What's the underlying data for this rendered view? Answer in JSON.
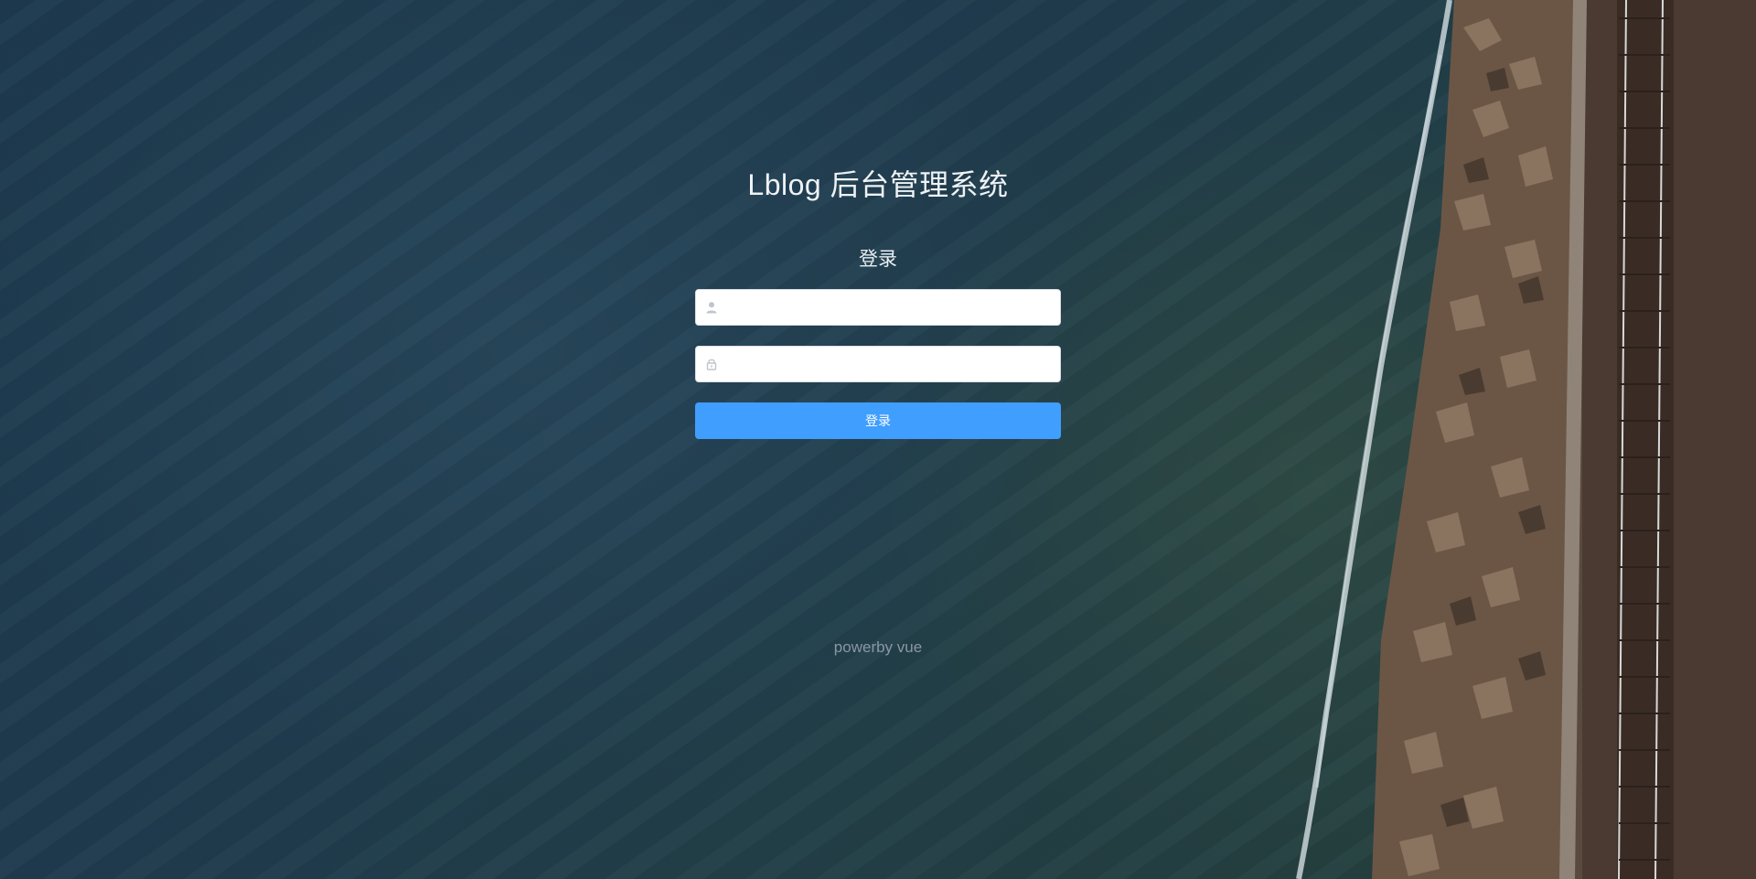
{
  "app": {
    "title": "Lblog 后台管理系统"
  },
  "login_form": {
    "heading": "登录",
    "username": {
      "value": "",
      "placeholder": "",
      "icon": "user-icon"
    },
    "password": {
      "value": "",
      "placeholder": "",
      "icon": "lock-icon"
    },
    "submit_label": "登录"
  },
  "footer": {
    "text": "powerby vue"
  },
  "colors": {
    "primary": "#409eff",
    "background_sea": "#1f3b4e",
    "title_text": "#eef2f5",
    "footer_text": "#8a97a3"
  }
}
